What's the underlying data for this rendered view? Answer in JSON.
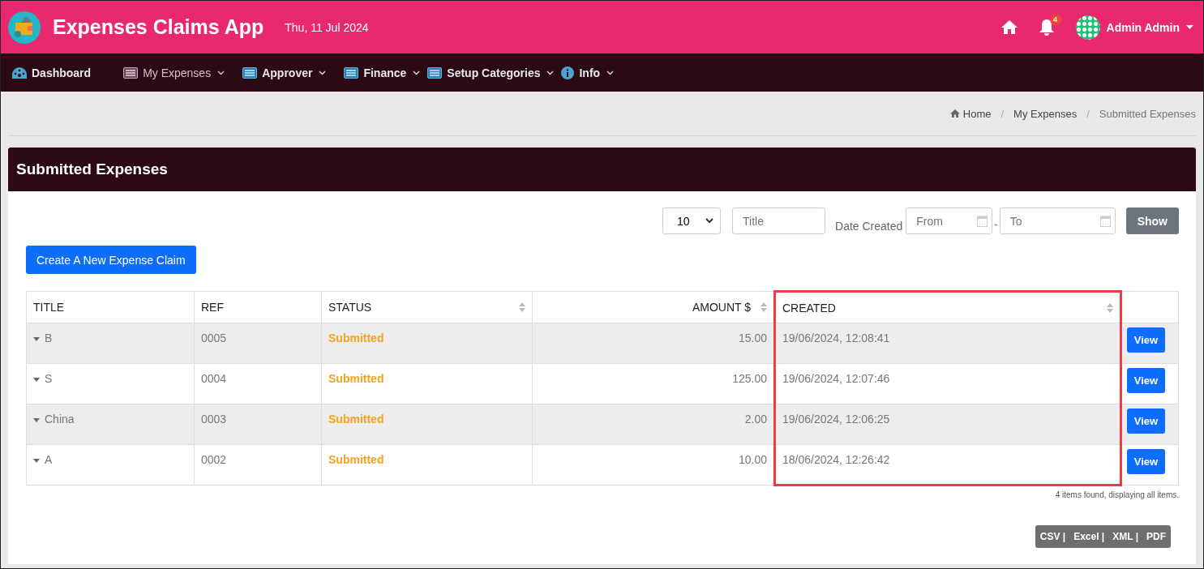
{
  "header": {
    "app_title": "Expenses Claims App",
    "date": "Thu, 11 Jul 2024",
    "notification_count": "4",
    "user_name": "Admin Admin"
  },
  "nav": [
    {
      "label": "Dashboard",
      "dropdown": false,
      "selected": false
    },
    {
      "label": "My Expenses",
      "dropdown": true,
      "selected": true
    },
    {
      "label": "Approver",
      "dropdown": true,
      "selected": false
    },
    {
      "label": "Finance",
      "dropdown": true,
      "selected": false
    },
    {
      "label": "Setup Categories",
      "dropdown": true,
      "selected": false
    },
    {
      "label": "Info",
      "dropdown": true,
      "selected": false
    }
  ],
  "breadcrumbs": [
    {
      "label": "Home"
    },
    {
      "separator": "/",
      "label": "My Expenses"
    },
    {
      "separator": "/",
      "label": "Submitted Expenses"
    }
  ],
  "card": {
    "title": "Submitted Expenses"
  },
  "filters": {
    "page_size": "10",
    "title_placeholder": "Title",
    "date_label": "Date Created",
    "from_placeholder": "From",
    "range_separator": "-",
    "to_placeholder": "To",
    "show_button": "Show"
  },
  "create_button": "Create A New Expense Claim",
  "table": {
    "columns": [
      {
        "label": "TITLE",
        "sortable": false,
        "highlighted": false
      },
      {
        "label": "REF",
        "sortable": false,
        "highlighted": false
      },
      {
        "label": "STATUS",
        "sortable": true,
        "highlighted": false
      },
      {
        "label": "AMOUNT $",
        "sortable": true,
        "highlighted": false
      },
      {
        "label": "CREATED",
        "sortable": true,
        "highlighted": true
      }
    ],
    "rows": [
      {
        "title": "B",
        "ref": "0005",
        "status": "Submitted",
        "amount": "15.00",
        "created": "19/06/2024, 12:08:41",
        "action": "View"
      },
      {
        "title": "S",
        "ref": "0004",
        "status": "Submitted",
        "amount": "125.00",
        "created": "19/06/2024, 12:07:46",
        "action": "View"
      },
      {
        "title": "China",
        "ref": "0003",
        "status": "Submitted",
        "amount": "2.00",
        "created": "19/06/2024, 12:06:25",
        "action": "View"
      },
      {
        "title": "A",
        "ref": "0002",
        "status": "Submitted",
        "amount": "10.00",
        "created": "18/06/2024, 12:26:42",
        "action": "View"
      }
    ]
  },
  "summary": "4 items found, displaying all items.",
  "export_links": [
    "CSV |",
    "Excel |",
    "XML |",
    "PDF"
  ]
}
